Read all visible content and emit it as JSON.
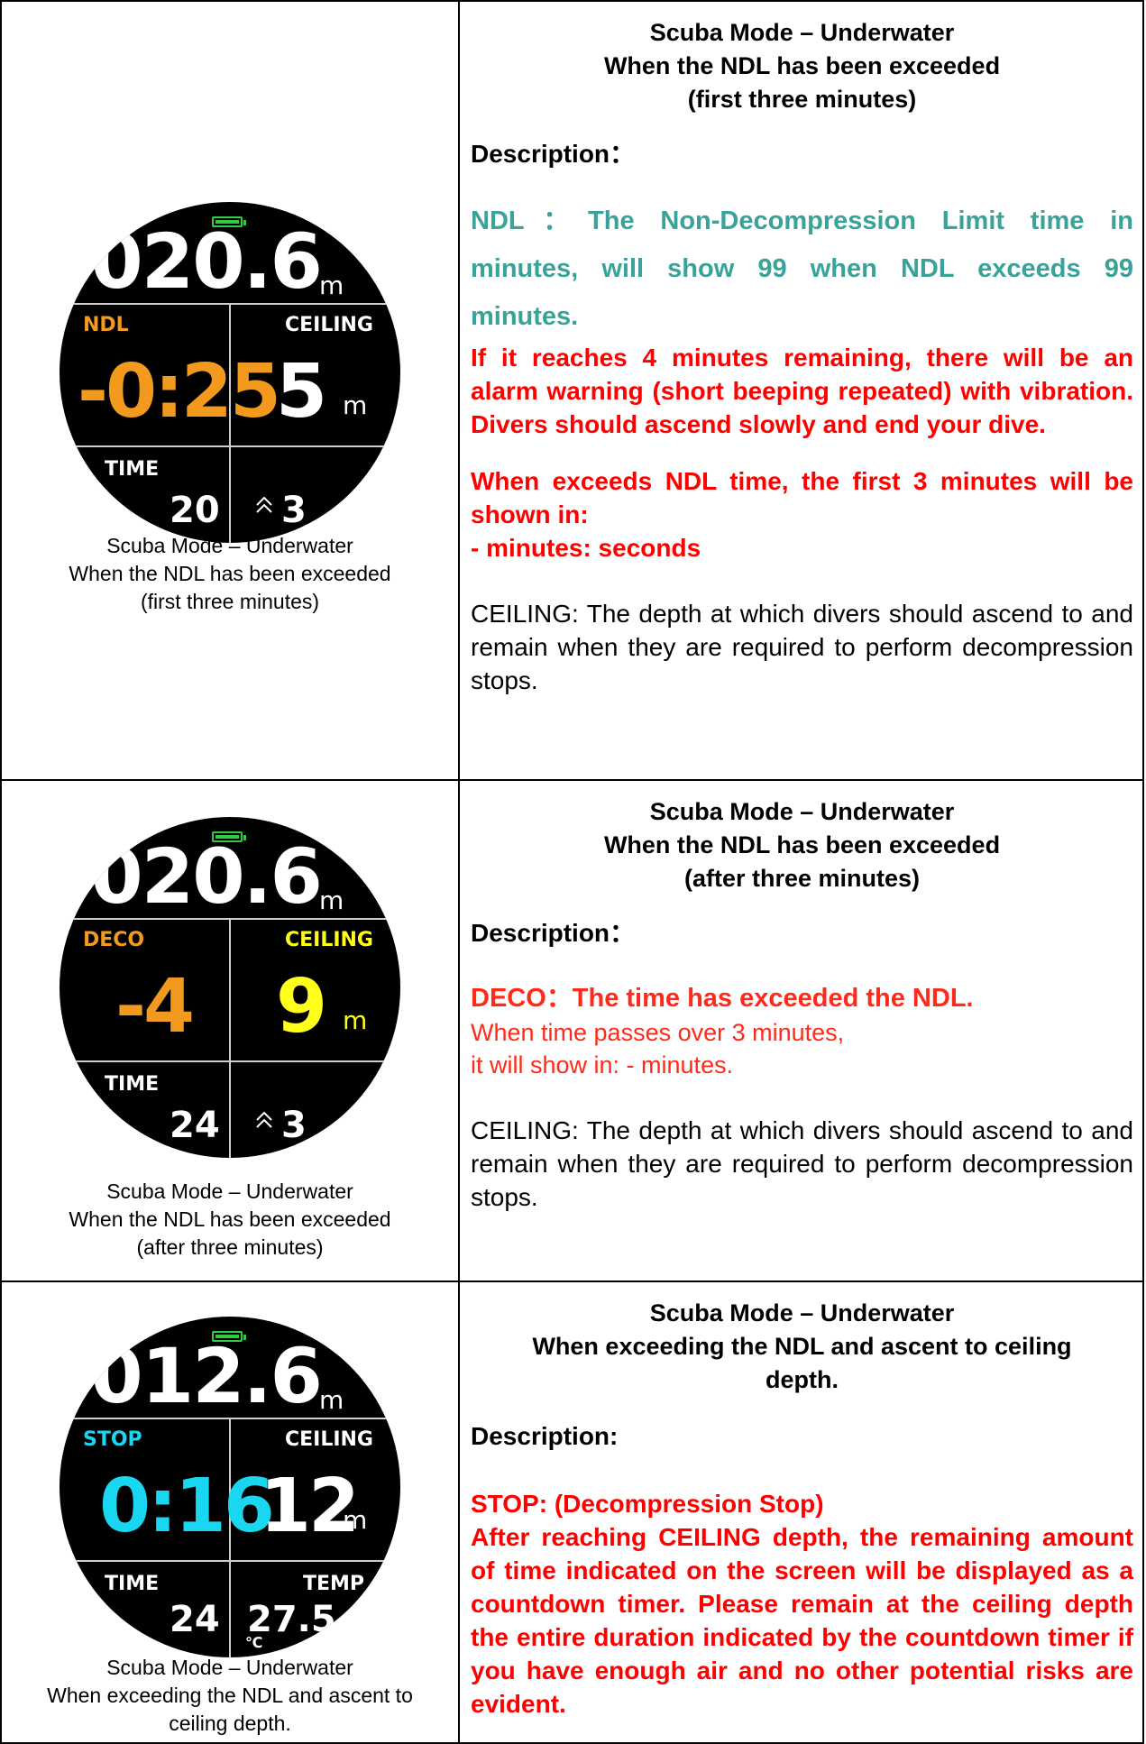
{
  "rows": [
    {
      "watch": {
        "depth": "020.6",
        "depth_unit": "m",
        "tl_label": "NDL",
        "tl_value": "-0:25",
        "tr_label": "CEILING",
        "tr_value": "5",
        "tr_unit": "m",
        "bl_label": "TIME",
        "bl_value": "20",
        "br_value": "3",
        "tl_color": "#f39a1e",
        "tr_color": "#ffffff"
      },
      "caption": [
        "Scuba Mode – Underwater",
        "When the NDL has been exceeded",
        "(first three minutes)"
      ],
      "title": [
        "Scuba Mode – Underwater",
        "When the NDL has been exceeded",
        "(first three minutes)"
      ],
      "desc_heading": "Description：",
      "ndl_text": "NDL：The Non-Decompression Limit time in minutes, will show 99 when NDL exceeds 99 minutes.",
      "alarm_text": "If it reaches 4 minutes remaining, there will be an alarm warning (short beeping repeated) with vibration. Divers should ascend slowly and end your dive.",
      "exceed_text": [
        "When exceeds NDL time, the first 3 minutes will be shown in:",
        "- minutes: seconds"
      ],
      "ceiling_text": "CEILING: The depth at which divers should ascend to and remain when they are required to perform decompression stops."
    },
    {
      "watch": {
        "depth": "020.6",
        "depth_unit": "m",
        "tl_label": "DECO",
        "tl_value": "-4",
        "tr_label": "CEILING",
        "tr_value": "9",
        "tr_unit": "m",
        "bl_label": "TIME",
        "bl_value": "24",
        "br_value": "3",
        "tl_color": "#f39a1e",
        "tr_color": "#ffff1a"
      },
      "caption": [
        "Scuba Mode – Underwater",
        "When the NDL has been exceeded",
        "(after three minutes)"
      ],
      "title": [
        "Scuba Mode – Underwater",
        "When the NDL has been exceeded",
        "(after three minutes)"
      ],
      "desc_heading": "Description：",
      "deco_heading": "DECO：The time has exceeded the NDL.",
      "deco_text": [
        "When time passes over 3 minutes,",
        "it will show in:  - minutes."
      ],
      "ceiling_text": "CEILING: The depth at which divers should ascend to and remain when they are required to perform decompression stops."
    },
    {
      "watch": {
        "depth": "012.6",
        "depth_unit": "m",
        "tl_label": "STOP",
        "tl_value": "0:16",
        "tr_label": "CEILING",
        "tr_value": "12",
        "tr_unit": "m",
        "bl_label": "TIME",
        "bl_value": "24",
        "br_label": "TEMP",
        "br_value": "27.5",
        "br_unit": "℃",
        "tl_color": "#19d7f0",
        "tr_color": "#ffffff"
      },
      "caption": [
        "Scuba Mode – Underwater",
        "When exceeding the NDL and ascent to",
        "ceiling depth."
      ],
      "title": [
        "Scuba Mode – Underwater",
        "When exceeding the NDL and ascent to ceiling",
        "depth."
      ],
      "desc_heading": "Description:",
      "stop_heading": "STOP: (Decompression Stop)",
      "stop_text": "After reaching CEILING depth, the remaining amount of time indicated on the screen will be displayed as a countdown timer. Please remain at the ceiling depth the entire duration indicated by the countdown timer if you have enough air and no other potential risks are evident."
    }
  ]
}
